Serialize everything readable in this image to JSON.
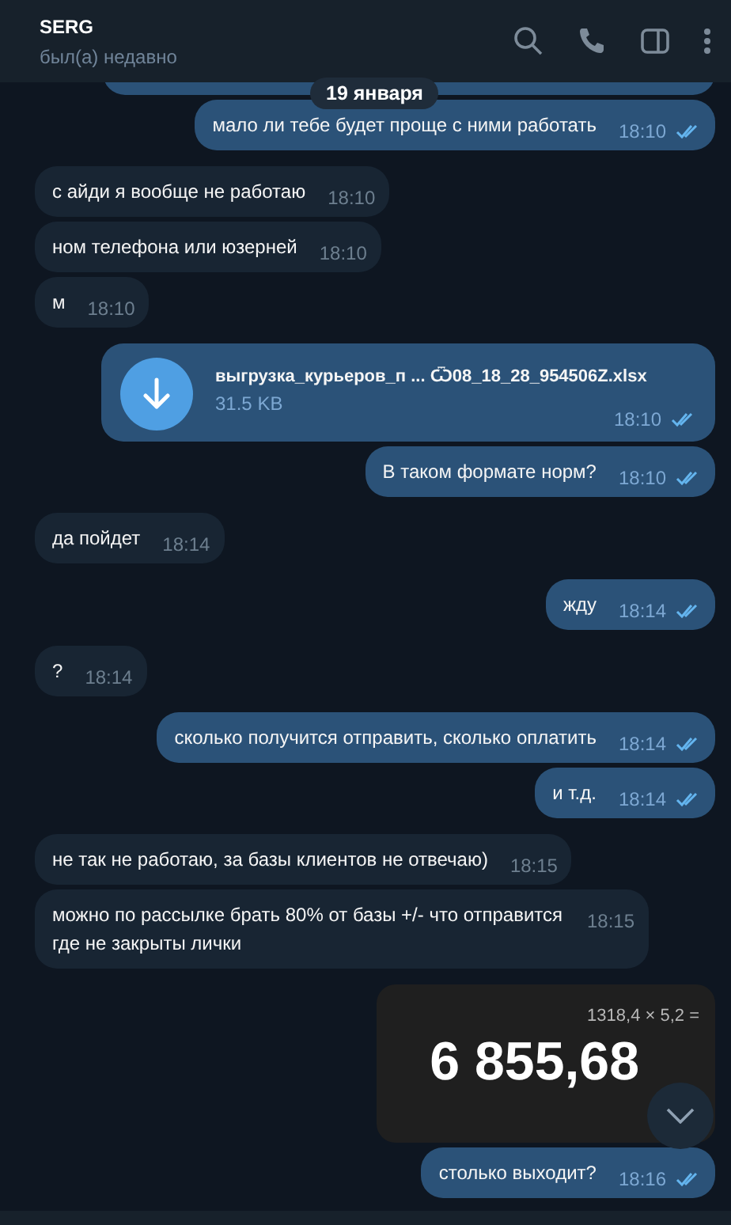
{
  "header": {
    "title": "SERG",
    "status": "был(а) недавно"
  },
  "date_pill": "19 января",
  "messages": [
    {
      "kind": "stub",
      "outgoing": true
    },
    {
      "kind": "text",
      "outgoing": true,
      "text": "мало ли тебе будет проще с ними работать",
      "time": "18:10",
      "read": true
    },
    {
      "kind": "text",
      "outgoing": false,
      "text": "с айди я вообще не работаю",
      "time": "18:10"
    },
    {
      "kind": "text",
      "outgoing": false,
      "text": "ном телефона или юзерней",
      "time": "18:10"
    },
    {
      "kind": "text",
      "outgoing": false,
      "text": "м",
      "time": "18:10"
    },
    {
      "kind": "file",
      "outgoing": true,
      "file_name": "выгрузка_курьеров_п  ...  Ѿ08_18_28_954506Z.xlsx",
      "size": "31.5 KB",
      "time": "18:10",
      "read": true
    },
    {
      "kind": "text",
      "outgoing": true,
      "text": "В таком формате норм?",
      "time": "18:10",
      "read": true
    },
    {
      "kind": "text",
      "outgoing": false,
      "text": "да пойдет",
      "time": "18:14"
    },
    {
      "kind": "text",
      "outgoing": true,
      "text": "жду",
      "time": "18:14",
      "read": true
    },
    {
      "kind": "text",
      "outgoing": false,
      "text": "?",
      "time": "18:14"
    },
    {
      "kind": "text",
      "outgoing": true,
      "text": "сколько получится отправить, сколько оплатить",
      "time": "18:14",
      "read": true
    },
    {
      "kind": "text",
      "outgoing": true,
      "text": "и т.д.",
      "time": "18:14",
      "read": true
    },
    {
      "kind": "text",
      "outgoing": false,
      "text": "не так не работаю, за базы клиентов не отвечаю)",
      "time": "18:15"
    },
    {
      "kind": "text",
      "outgoing": false,
      "text": "можно по рассылке брать 80% от базы +/- что отправится где не закрыты лички",
      "time": "18:15"
    },
    {
      "kind": "image",
      "outgoing": true,
      "expression": "1318,4 × 5,2 =",
      "result": "6 855,68"
    },
    {
      "kind": "text",
      "outgoing": true,
      "text": "столько выходит?",
      "time": "18:16",
      "read": true
    }
  ]
}
